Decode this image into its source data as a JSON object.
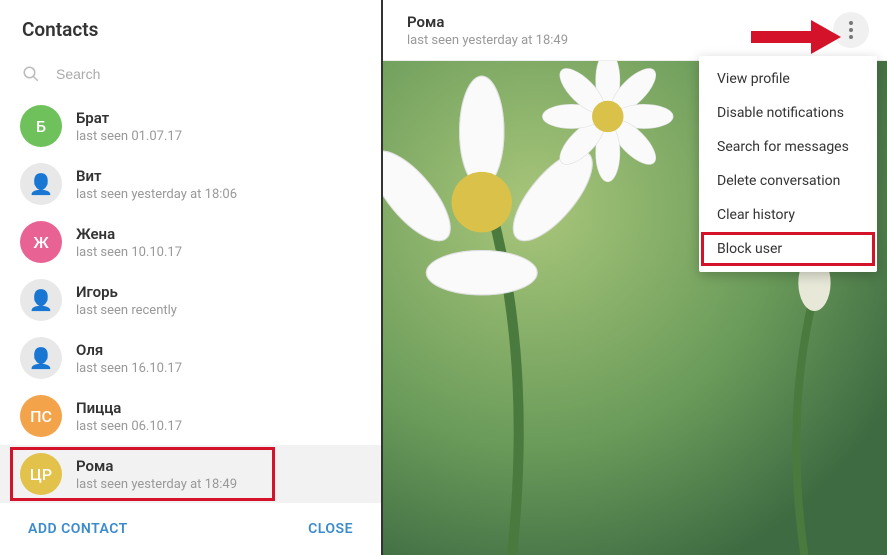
{
  "sidebar": {
    "title": "Contacts",
    "search_placeholder": "Search",
    "contacts": [
      {
        "avatar_type": "letter",
        "avatar_text": "Б",
        "avatar_color": "green",
        "name": "Брат",
        "status": "last seen 01.07.17"
      },
      {
        "avatar_type": "photo",
        "avatar_text": "",
        "avatar_color": "",
        "name": "Вит",
        "status": "last seen yesterday at 18:06"
      },
      {
        "avatar_type": "letter",
        "avatar_text": "Ж",
        "avatar_color": "pink",
        "name": "Жена",
        "status": "last seen 10.10.17"
      },
      {
        "avatar_type": "photo",
        "avatar_text": "",
        "avatar_color": "",
        "name": "Игорь",
        "status": "last seen recently"
      },
      {
        "avatar_type": "photo",
        "avatar_text": "",
        "avatar_color": "",
        "name": "Оля",
        "status": "last seen 16.10.17"
      },
      {
        "avatar_type": "letter",
        "avatar_text": "ПС",
        "avatar_color": "orange",
        "name": "Пицца",
        "status": "last seen 06.10.17"
      },
      {
        "avatar_type": "letter",
        "avatar_text": "ЦР",
        "avatar_color": "yellow",
        "name": "Рома",
        "status": "last seen yesterday at 18:49"
      }
    ],
    "add_contact_label": "ADD CONTACT",
    "close_label": "CLOSE",
    "selected_index": 6
  },
  "chat": {
    "name": "Рома",
    "status": "last seen yesterday at 18:49"
  },
  "menu": {
    "items": [
      "View profile",
      "Disable notifications",
      "Search for messages",
      "Delete conversation",
      "Clear history",
      "Block user"
    ],
    "highlighted_index": 5
  }
}
